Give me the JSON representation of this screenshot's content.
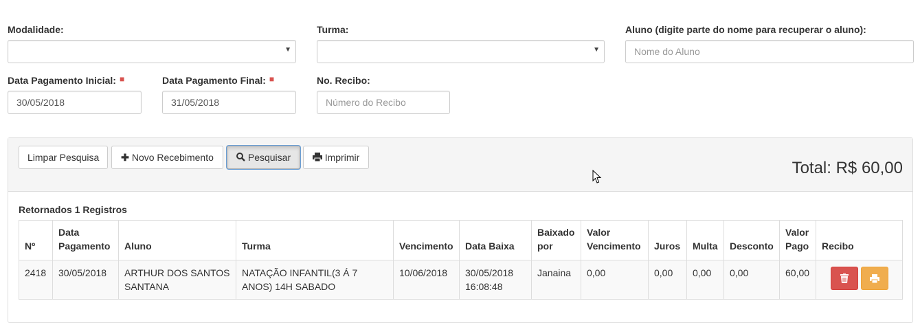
{
  "filters": {
    "modalidade_label": "Modalidade:",
    "turma_label": "Turma:",
    "aluno_label": "Aluno (digite parte do nome para recuperar o aluno):",
    "aluno_placeholder": "Nome do Aluno",
    "data_inicial_label": "Data Pagamento Inicial:",
    "data_inicial_value": "30/05/2018",
    "data_final_label": "Data Pagamento Final:",
    "data_final_value": "31/05/2018",
    "recibo_label": "No. Recibo:",
    "recibo_placeholder": "Número do Recibo",
    "required_mark": "■"
  },
  "toolbar": {
    "limpar_label": "Limpar Pesquisa",
    "novo_label": "Novo Recebimento",
    "pesquisar_label": "Pesquisar",
    "imprimir_label": "Imprimir",
    "total_text": "Total: R$ 60,00"
  },
  "results": {
    "count_text": "Retornados 1 Registros",
    "columns": [
      "Nº",
      "Data Pagamento",
      "Aluno",
      "Turma",
      "Vencimento",
      "Data Baixa",
      "Baixado por",
      "Valor Vencimento",
      "Juros",
      "Multa",
      "Desconto",
      "Valor Pago",
      "Recibo"
    ],
    "rows": [
      {
        "numero": "2418",
        "data_pagamento": "30/05/2018",
        "aluno": "ARTHUR DOS SANTOS SANTANA",
        "turma": "NATAÇÃO INFANTIL(3 Á 7 ANOS) 14H SABADO",
        "vencimento": "10/06/2018",
        "data_baixa": "30/05/2018 16:08:48",
        "baixado_por": "Janaina",
        "valor_vencimento": "0,00",
        "juros": "0,00",
        "multa": "0,00",
        "desconto": "0,00",
        "valor_pago": "60,00"
      }
    ]
  },
  "icons": {
    "plus": "plus-icon",
    "search": "search-icon",
    "print": "print-icon",
    "trash": "trash-icon",
    "caret": "caret-down-icon",
    "cursor": "mouse-cursor-icon"
  },
  "colors": {
    "danger": "#d9534f",
    "warning": "#f0ad4e",
    "panel_bg": "#f5f5f5"
  }
}
